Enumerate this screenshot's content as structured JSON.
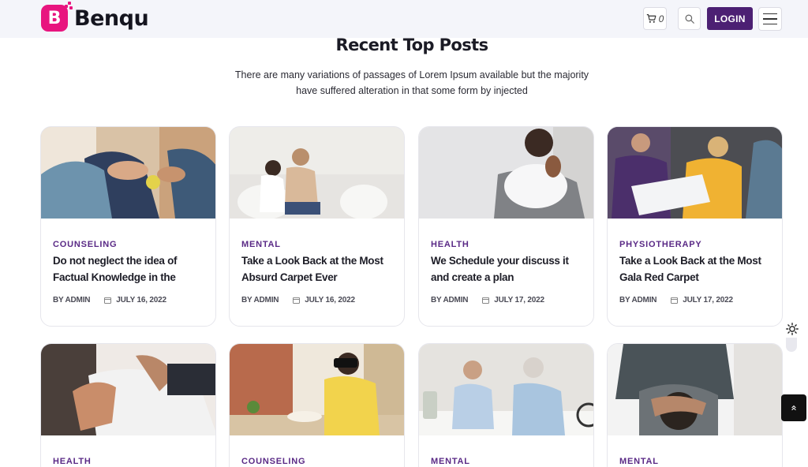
{
  "header": {
    "logo_letter": "B",
    "logo_text": "Benqu",
    "cart_count": "0",
    "login_label": "LOGIN"
  },
  "section": {
    "title": "Recent Top Posts",
    "subtitle_line1": "There are many variations of passages of Lorem Ipsum available but the majority",
    "subtitle_line2": "have suffered alteration in that some form by injected"
  },
  "posts": [
    {
      "category": "COUNSELING",
      "title": "Do not neglect the idea of Factual Knowledge in the",
      "author": "BY ADMIN",
      "date": "JULY 16, 2022"
    },
    {
      "category": "MENTAL",
      "title": "Take a Look Back at the Most Absurd Carpet Ever",
      "author": "BY ADMIN",
      "date": "JULY 16, 2022"
    },
    {
      "category": "HEALTH",
      "title": "We Schedule your discuss it and create a plan",
      "author": "BY ADMIN",
      "date": "JULY 17, 2022"
    },
    {
      "category": "PHYSIOTHERAPY",
      "title": "Take a Look Back at the Most Gala Red Carpet",
      "author": "BY ADMIN",
      "date": "JULY 17, 2022"
    },
    {
      "category": "HEALTH"
    },
    {
      "category": "COUNSELING"
    },
    {
      "category": "MENTAL"
    },
    {
      "category": "MENTAL"
    }
  ],
  "icons": {
    "cart": "cart-icon",
    "search": "search-icon",
    "menu": "hamburger-menu-icon",
    "calendar": "calendar-icon",
    "theme": "sun-icon",
    "scroll_top": "chevron-up-icon"
  },
  "colors": {
    "brand_pink": "#e8157f",
    "accent_purple": "#4c2073",
    "category_purple": "#5a2a86",
    "header_bg": "#f4f5fa"
  }
}
